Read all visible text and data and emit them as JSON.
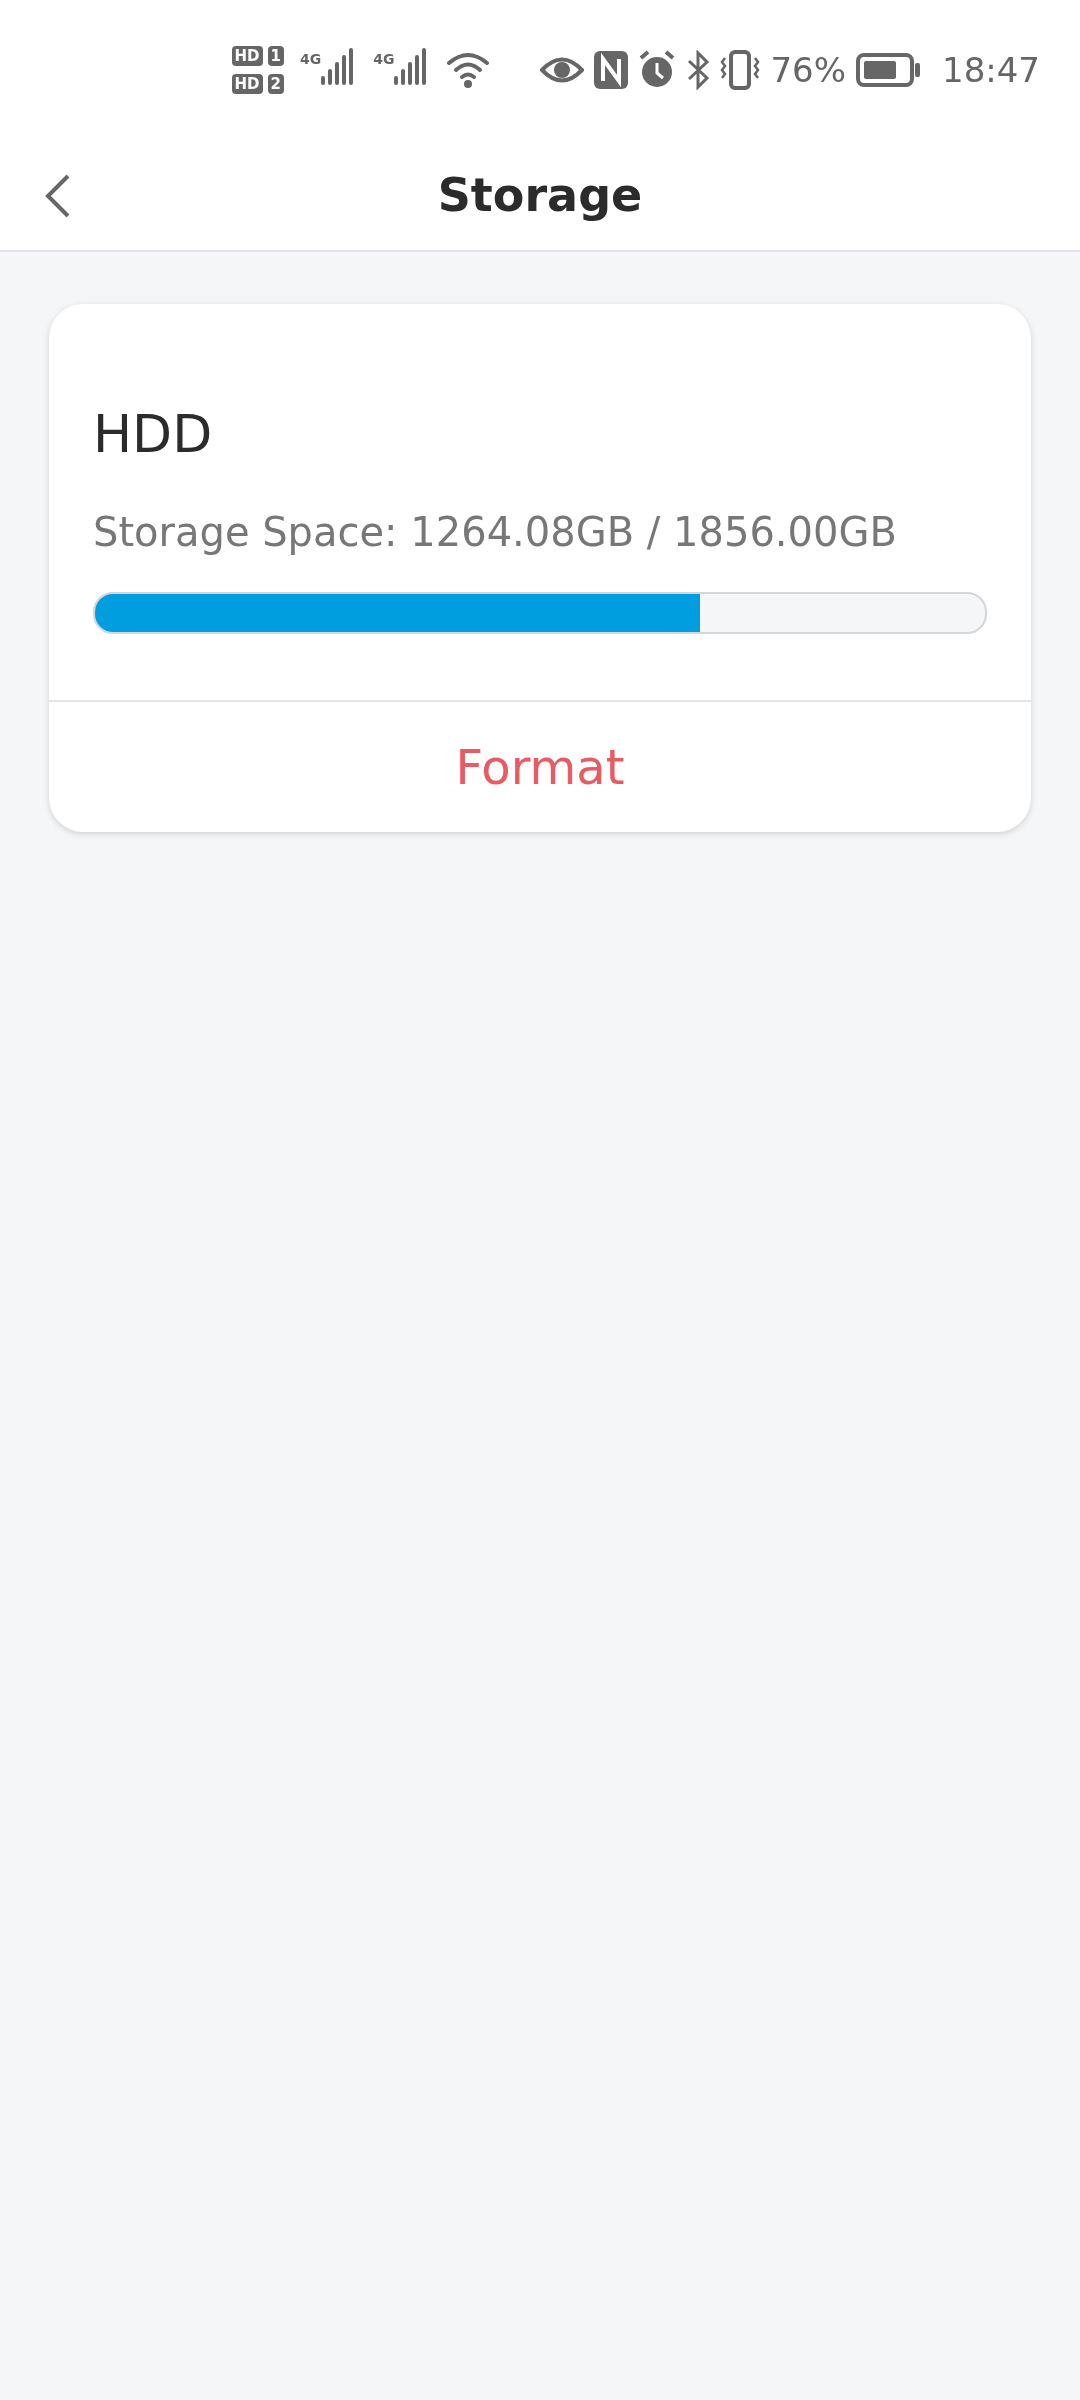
{
  "status_bar": {
    "sims": [
      {
        "badge": "HD",
        "slot": "1"
      },
      {
        "badge": "HD",
        "slot": "2"
      }
    ],
    "networks": [
      "4G",
      "4G"
    ],
    "battery": "76%",
    "time": "18:47"
  },
  "header": {
    "title": "Storage"
  },
  "card": {
    "name": "HDD",
    "storage_text": "Storage Space: 1264.08GB / 1856.00GB",
    "level": 0.68,
    "action": "Format"
  }
}
